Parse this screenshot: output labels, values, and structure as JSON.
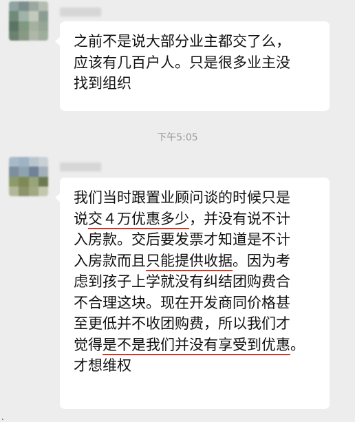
{
  "chat": {
    "messages": [
      {
        "lines": [
          "之前不是说大部分业主都交了么，",
          "应该有几百户人。只是很多业主没",
          "找到组织"
        ]
      },
      {
        "lines": [
          [
            {
              "t": "我们当时跟置业顾问谈的时候只是"
            }
          ],
          [
            {
              "t": "说"
            },
            {
              "t": "交４万优惠多少",
              "u": true
            },
            {
              "t": "，并没有说不计"
            }
          ],
          [
            {
              "t": "入房款。交后要发票才知道是不计"
            }
          ],
          [
            {
              "t": "入房款而且"
            },
            {
              "t": "只能提供收据",
              "u": true
            },
            {
              "t": "。因为考"
            }
          ],
          [
            {
              "t": "虑到孩子上学就没有纠结团购费合"
            }
          ],
          [
            {
              "t": "不合理这块。现在开发商同价格甚"
            }
          ],
          [
            {
              "t": "至更低并不收团购费，所以我们才"
            }
          ],
          [
            {
              "t": "觉得"
            },
            {
              "t": "是不是我们并没有享受到优惠",
              "u": true
            },
            {
              "t": "。"
            }
          ],
          [
            {
              "t": "才想维权"
            }
          ]
        ]
      }
    ],
    "timestamp": "下午5:05",
    "stray_mark": "."
  },
  "colors": {
    "background": "#ededed",
    "bubble": "#ffffff",
    "underline": "#e0301e",
    "timestamp": "#9a9a9a"
  }
}
